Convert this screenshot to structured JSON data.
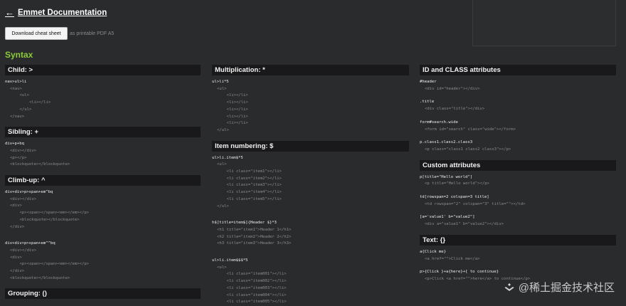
{
  "header": {
    "back_arrow": "←",
    "title": "Emmet Documentation"
  },
  "download": {
    "button": "Download cheat sheet",
    "note": "as printable PDF A5"
  },
  "syntax_title": "Syntax",
  "columns": [
    {
      "sections": [
        {
          "title": "Child: >",
          "examples": [
            {
              "abbr": "nav>ul>li",
              "output": "<nav>\n    <ul>\n        <li></li>\n    </ul>\n</nav>"
            }
          ]
        },
        {
          "title": "Sibling: +",
          "examples": [
            {
              "abbr": "div+p+bq",
              "output": "<div></div>\n<p></p>\n<blockquote></blockquote>"
            }
          ]
        },
        {
          "title": "Climb-up: ^",
          "examples": [
            {
              "abbr": "div+div>p>span+em^bq",
              "output": "<div></div>\n<div>\n    <p><span></span><em></em></p>\n    <blockquote></blockquote>\n</div>"
            },
            {
              "abbr": "div+div>p>span+em^^bq",
              "output": "<div></div>\n<div>\n    <p><span></span><em></em></p>\n</div>\n<blockquote></blockquote>"
            }
          ]
        },
        {
          "title": "Grouping: ()",
          "examples": []
        }
      ]
    },
    {
      "sections": [
        {
          "title": "Multiplication: *",
          "examples": [
            {
              "abbr": "ul>li*5",
              "output": "<ul>\n    <li></li>\n    <li></li>\n    <li></li>\n    <li></li>\n    <li></li>\n</ul>"
            }
          ]
        },
        {
          "title": "Item numbering: $",
          "examples": [
            {
              "abbr": "ul>li.item$*5",
              "output": "<ul>\n    <li class=\"item1\"></li>\n    <li class=\"item2\"></li>\n    <li class=\"item3\"></li>\n    <li class=\"item4\"></li>\n    <li class=\"item5\"></li>\n</ul>"
            },
            {
              "abbr": "h$[title=item$]{Header $}*3",
              "output": "<h1 title=\"item1\">Header 1</h1>\n<h2 title=\"item2\">Header 2</h2>\n<h3 title=\"item3\">Header 3</h3>"
            },
            {
              "abbr": "ul>li.item$$$*5",
              "output": "<ul>\n    <li class=\"item001\"></li>\n    <li class=\"item002\"></li>\n    <li class=\"item003\"></li>\n    <li class=\"item004\"></li>\n    <li class=\"item005\"></li>"
            }
          ]
        }
      ]
    },
    {
      "sections": [
        {
          "title": "ID and CLASS attributes",
          "examples": [
            {
              "abbr": "#header",
              "output": "<div id=\"header\"></div>"
            },
            {
              "abbr": ".title",
              "output": "<div class=\"title\"></div>"
            },
            {
              "abbr": "form#search.wide",
              "output": "<form id=\"search\" class=\"wide\"></form>"
            },
            {
              "abbr": "p.class1.class2.class3",
              "output": "<p class=\"class1 class2 class3\"></p>"
            }
          ]
        },
        {
          "title": "Custom attributes",
          "examples": [
            {
              "abbr": "p[title=\"Hello world\"]",
              "output": "<p title=\"Hello world\"></p>"
            },
            {
              "abbr": "td[rowspan=2 colspan=3 title]",
              "output": "<td rowspan=\"2\" colspan=\"3\" title=\"\"></td>"
            },
            {
              "abbr": "[a='value1' b=\"value2\"]",
              "output": "<div a=\"value1\" b=\"value2\"></div>"
            }
          ]
        },
        {
          "title": "Text: {}",
          "examples": [
            {
              "abbr": "a{Click me}",
              "output": "<a href=\"\">Click me</a>"
            },
            {
              "abbr": "p>{Click }+a{here}+{ to continue}",
              "output": "<p>Click <a href=\"\">here</a> to continue</p>"
            }
          ]
        }
      ]
    }
  ],
  "watermark": {
    "text": "@稀土掘金技术社区",
    "icon": "juejin-logo-icon"
  },
  "colors": {
    "background": "#2a2b2d",
    "section_header": "#19191b",
    "accent_green": "#8ccb3a"
  }
}
